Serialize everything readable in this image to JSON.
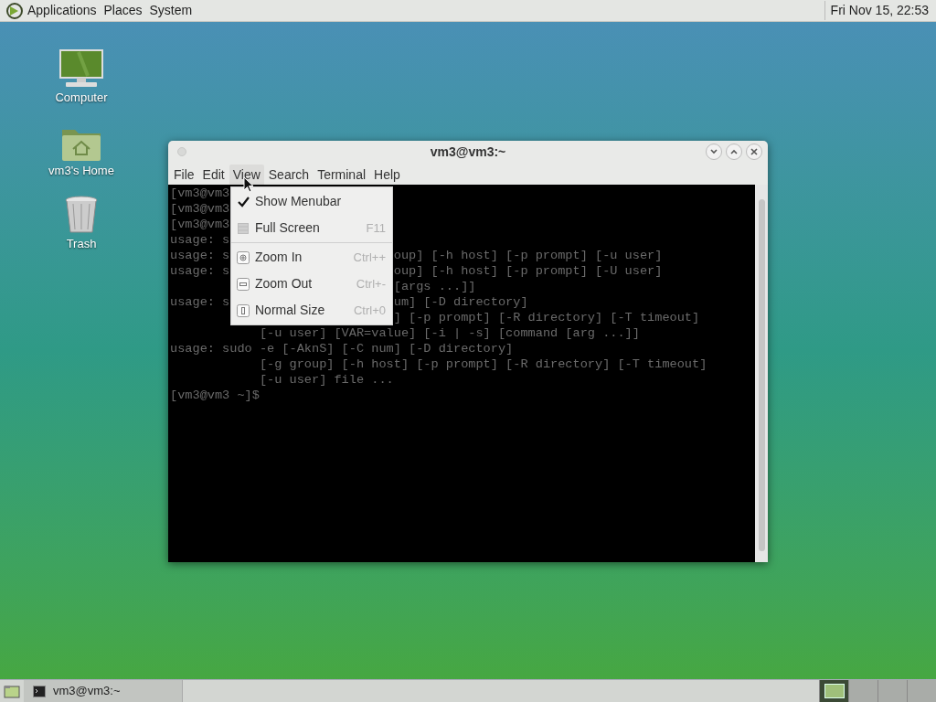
{
  "top_panel": {
    "menus": [
      "Applications",
      "Places",
      "System"
    ],
    "clock": "Fri Nov 15, 22:53"
  },
  "desktop_icons": [
    {
      "kind": "computer",
      "label": "Computer"
    },
    {
      "kind": "home",
      "label": "vm3's Home"
    },
    {
      "kind": "trash",
      "label": "Trash"
    }
  ],
  "window": {
    "title": "vm3@vm3:~",
    "menubar": [
      {
        "label": "File",
        "selected": false
      },
      {
        "label": "Edit",
        "selected": false
      },
      {
        "label": "View",
        "selected": true
      },
      {
        "label": "Search",
        "selected": false
      },
      {
        "label": "Terminal",
        "selected": false
      },
      {
        "label": "Help",
        "selected": false
      }
    ],
    "terminal_lines": [
      {
        "left": "[vm3@vm3"
      },
      {
        "left": "[vm3@vm3"
      },
      {
        "left": "[vm3@vm3"
      },
      {
        "left": "usage: s"
      },
      {
        "left": "usage: s",
        "right": "oup] [-h host] [-p prompt] [-u user]"
      },
      {
        "left": "usage: s",
        "right": "oup] [-h host] [-p prompt] [-U user]"
      },
      {
        "right": "[args ...]]"
      },
      {
        "left": "usage: s",
        "right": "um] [-D directory]"
      },
      {
        "right": "] [-p prompt] [-R directory] [-T timeout]"
      },
      {
        "left": "            [-u user] [VAR=value] [-i | -s] [command [arg ...]]"
      },
      {
        "left": "usage: sudo -e [-AknS] [-C num] [-D directory]"
      },
      {
        "left": "            [-g group] [-h host] [-p prompt] [-R directory] [-T timeout]"
      },
      {
        "left": "            [-u user] file ..."
      },
      {
        "left": "[vm3@vm3 ~]$"
      }
    ]
  },
  "view_menu": [
    {
      "kind": "toggle",
      "label": "Show Menubar",
      "checked": true
    },
    {
      "kind": "toggle",
      "label": "Full Screen",
      "shortcut": "F11",
      "checked": false
    },
    {
      "kind": "separator"
    },
    {
      "kind": "zoom-in",
      "label": "Zoom In",
      "shortcut": "Ctrl++"
    },
    {
      "kind": "zoom-out",
      "label": "Zoom Out",
      "shortcut": "Ctrl+-"
    },
    {
      "kind": "normal-size",
      "label": "Normal Size",
      "shortcut": "Ctrl+0"
    }
  ],
  "taskbar": {
    "tasks": [
      {
        "label": "vm3@vm3:~"
      }
    ],
    "workspaces": [
      {
        "selected": true
      },
      {
        "selected": false
      },
      {
        "selected": false
      },
      {
        "selected": false
      }
    ]
  }
}
